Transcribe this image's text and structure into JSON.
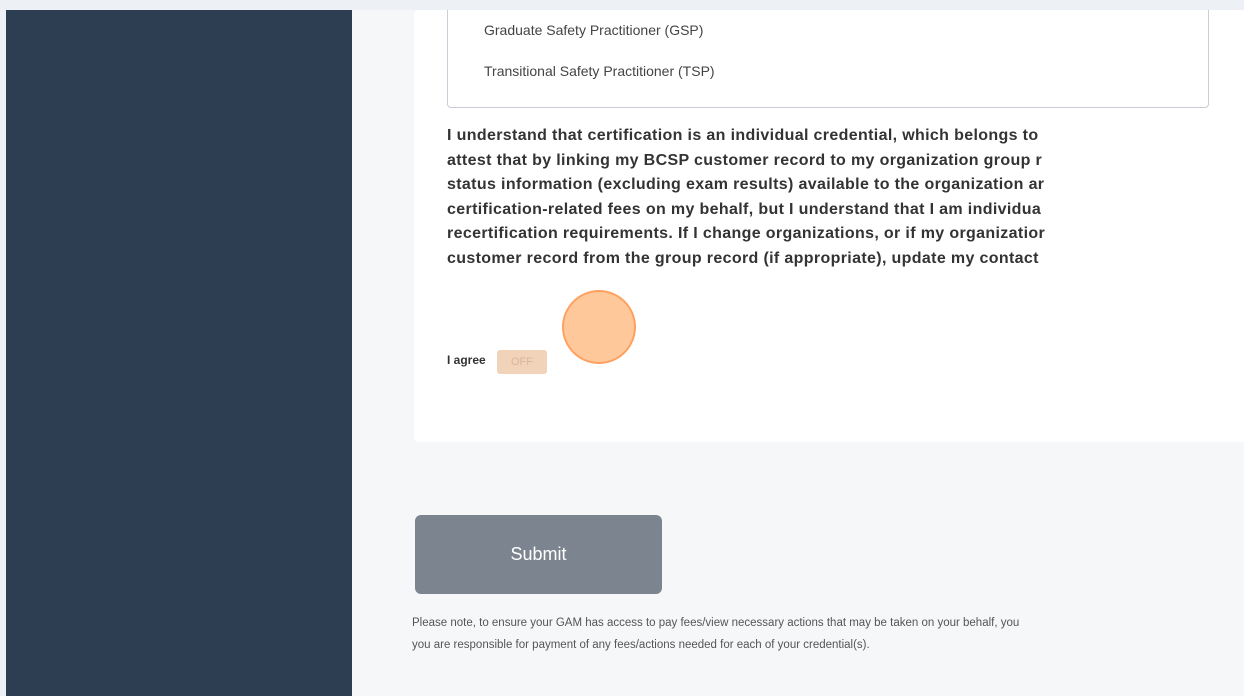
{
  "dropdown": {
    "options": [
      "Graduate Safety Practitioner (GSP)",
      "Transitional Safety Practitioner (TSP)"
    ]
  },
  "attestation": {
    "lines": [
      "I understand that certification is an individual credential, which belongs to",
      "attest that by linking my BCSP customer record to my organization group r",
      "status information (excluding exam results) available to the organization ar",
      "certification-related fees on my behalf, but I understand that I am individua",
      "recertification requirements. If I change organizations, or if my organizatior",
      "customer record from the group record (if appropriate), update my contact"
    ]
  },
  "agree": {
    "label": "I agree",
    "toggle_text": "OFF"
  },
  "submit": {
    "label": "Submit"
  },
  "note": {
    "lines": [
      "Please note, to ensure your GAM has access to pay fees/view necessary actions that may be taken on your behalf, you",
      "you are responsible for payment of any fees/actions needed for each of your credential(s)."
    ]
  }
}
